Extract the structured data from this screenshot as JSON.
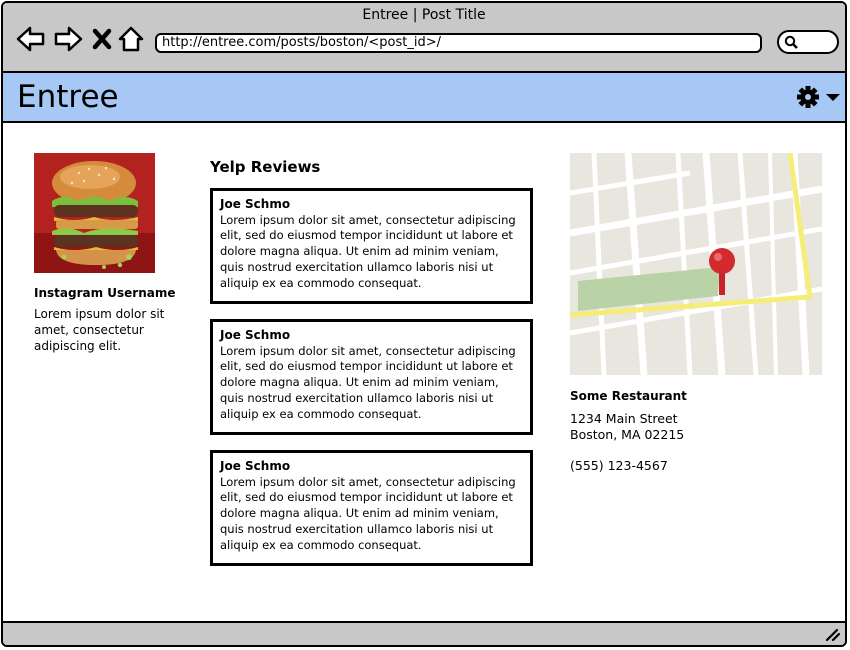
{
  "window": {
    "title": "Entree | Post Title"
  },
  "browser": {
    "url": "http://entree.com/posts/boston/<post_id>/",
    "nav_icons": [
      "back-icon",
      "forward-icon",
      "close-icon",
      "home-icon"
    ],
    "search_icon": "search-icon"
  },
  "app": {
    "title": "Entree",
    "accent": "#a7c7f5",
    "settings_icon": "gear-icon"
  },
  "instagram": {
    "photo": "burger-photo",
    "username": "Instagram Username",
    "caption": "Lorem ipsum dolor sit amet, consectetur adipiscing elit."
  },
  "reviews": {
    "heading": "Yelp Reviews",
    "items": [
      {
        "author": "Joe Schmo",
        "text": "Lorem ipsum dolor sit amet, consectetur adipiscing elit, sed do eiusmod tempor incididunt ut labore et dolore magna aliqua. Ut enim ad minim veniam, quis nostrud exercitation ullamco laboris nisi ut aliquip ex ea commodo consequat."
      },
      {
        "author": "Joe Schmo",
        "text": "Lorem ipsum dolor sit amet, consectetur adipiscing elit, sed do eiusmod tempor incididunt ut labore et dolore magna aliqua. Ut enim ad minim veniam, quis nostrud exercitation ullamco laboris nisi ut aliquip ex ea commodo consequat."
      },
      {
        "author": "Joe Schmo",
        "text": "Lorem ipsum dolor sit amet, consectetur adipiscing elit, sed do eiusmod tempor incididunt ut labore et dolore magna aliqua. Ut enim ad minim veniam, quis nostrud exercitation ullamco laboris nisi ut aliquip ex ea commodo consequat."
      }
    ]
  },
  "restaurant": {
    "name": "Some Restaurant",
    "street": "1234 Main Street",
    "city": "Boston, MA 02215",
    "phone": "(555) 123-4567",
    "map_icon": "map-pin-icon"
  }
}
